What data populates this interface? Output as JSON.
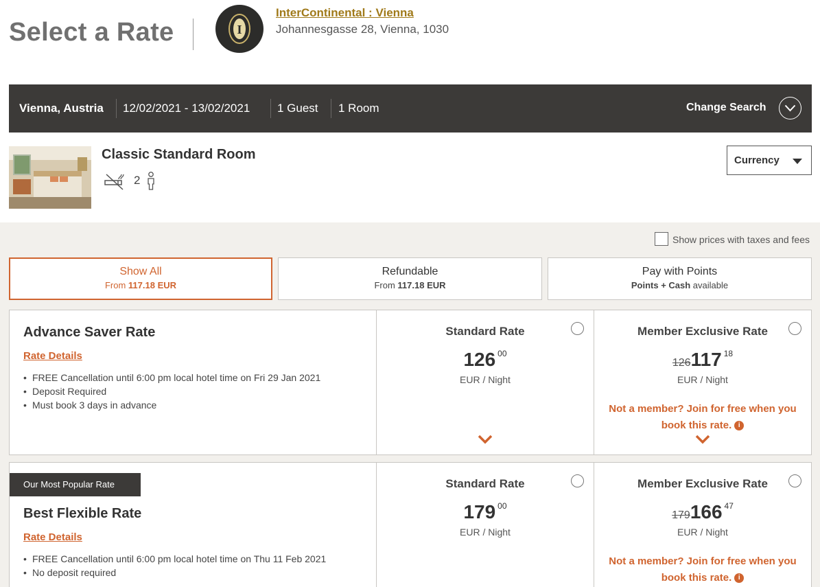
{
  "header": {
    "title": "Select a Rate",
    "hotel_name": "InterContinental : Vienna",
    "hotel_address": "Johannesgasse 28, Vienna, 1030",
    "logo_letter": "I"
  },
  "search": {
    "location": "Vienna, Austria",
    "dates": "12/02/2021 - 13/02/2021",
    "guests": "1 Guest",
    "rooms": "1 Room",
    "change_label": "Change Search"
  },
  "room": {
    "name": "Classic Standard Room",
    "guests": "2",
    "currency_label": "Currency"
  },
  "tax_toggle_label": "Show prices with taxes and fees",
  "filters": [
    {
      "title": "Show All",
      "sub_prefix": "From ",
      "sub_bold": "117.18 EUR",
      "sub_suffix": ""
    },
    {
      "title": "Refundable",
      "sub_prefix": "From ",
      "sub_bold": "117.18 EUR",
      "sub_suffix": ""
    },
    {
      "title": "Pay with Points",
      "sub_prefix": "",
      "sub_bold": "Points + Cash",
      "sub_suffix": " available"
    }
  ],
  "rates": [
    {
      "title": "Advance Saver Rate",
      "details_label": "Rate Details",
      "bullets": [
        "FREE Cancellation until 6:00 pm local hotel time on Fri 29 Jan 2021",
        "Deposit Required",
        "Must book 3 days in advance"
      ],
      "standard": {
        "label": "Standard Rate",
        "price": "126",
        "cents": "00",
        "per": "EUR / Night"
      },
      "member": {
        "label": "Member Exclusive Rate",
        "old_price": "126",
        "price": "117",
        "cents": "18",
        "per": "EUR / Night",
        "join": "Not a member? Join for free when you book this rate."
      }
    },
    {
      "badge": "Our Most Popular Rate",
      "title": "Best Flexible Rate",
      "details_label": "Rate Details",
      "bullets": [
        "FREE Cancellation until 6:00 pm local hotel time on Thu 11 Feb 2021",
        "No deposit required"
      ],
      "standard": {
        "label": "Standard Rate",
        "price": "179",
        "cents": "00",
        "per": "EUR / Night"
      },
      "member": {
        "label": "Member Exclusive Rate",
        "old_price": "179",
        "price": "166",
        "cents": "47",
        "per": "EUR / Night",
        "join": "Not a member? Join for free when you book this rate."
      }
    }
  ],
  "colors": {
    "accent": "#d0642f",
    "bar": "#3c3a38",
    "gold": "#a07a1a"
  }
}
